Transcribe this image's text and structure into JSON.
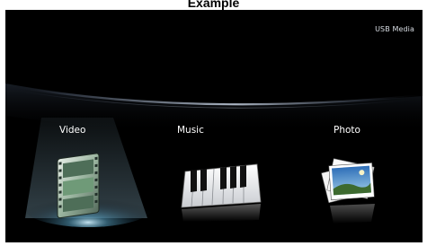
{
  "caption": "Example",
  "header": {
    "source_label": "USB Media"
  },
  "menu": {
    "selected": "video",
    "items": [
      {
        "id": "video",
        "label": "Video",
        "icon": "film-strip-icon"
      },
      {
        "id": "music",
        "label": "Music",
        "icon": "piano-keys-icon"
      },
      {
        "id": "photo",
        "label": "Photo",
        "icon": "photo-stack-icon"
      }
    ]
  },
  "colors": {
    "background": "#000000",
    "text": "#ffffff",
    "accent_glow": "#5aa6c8"
  }
}
